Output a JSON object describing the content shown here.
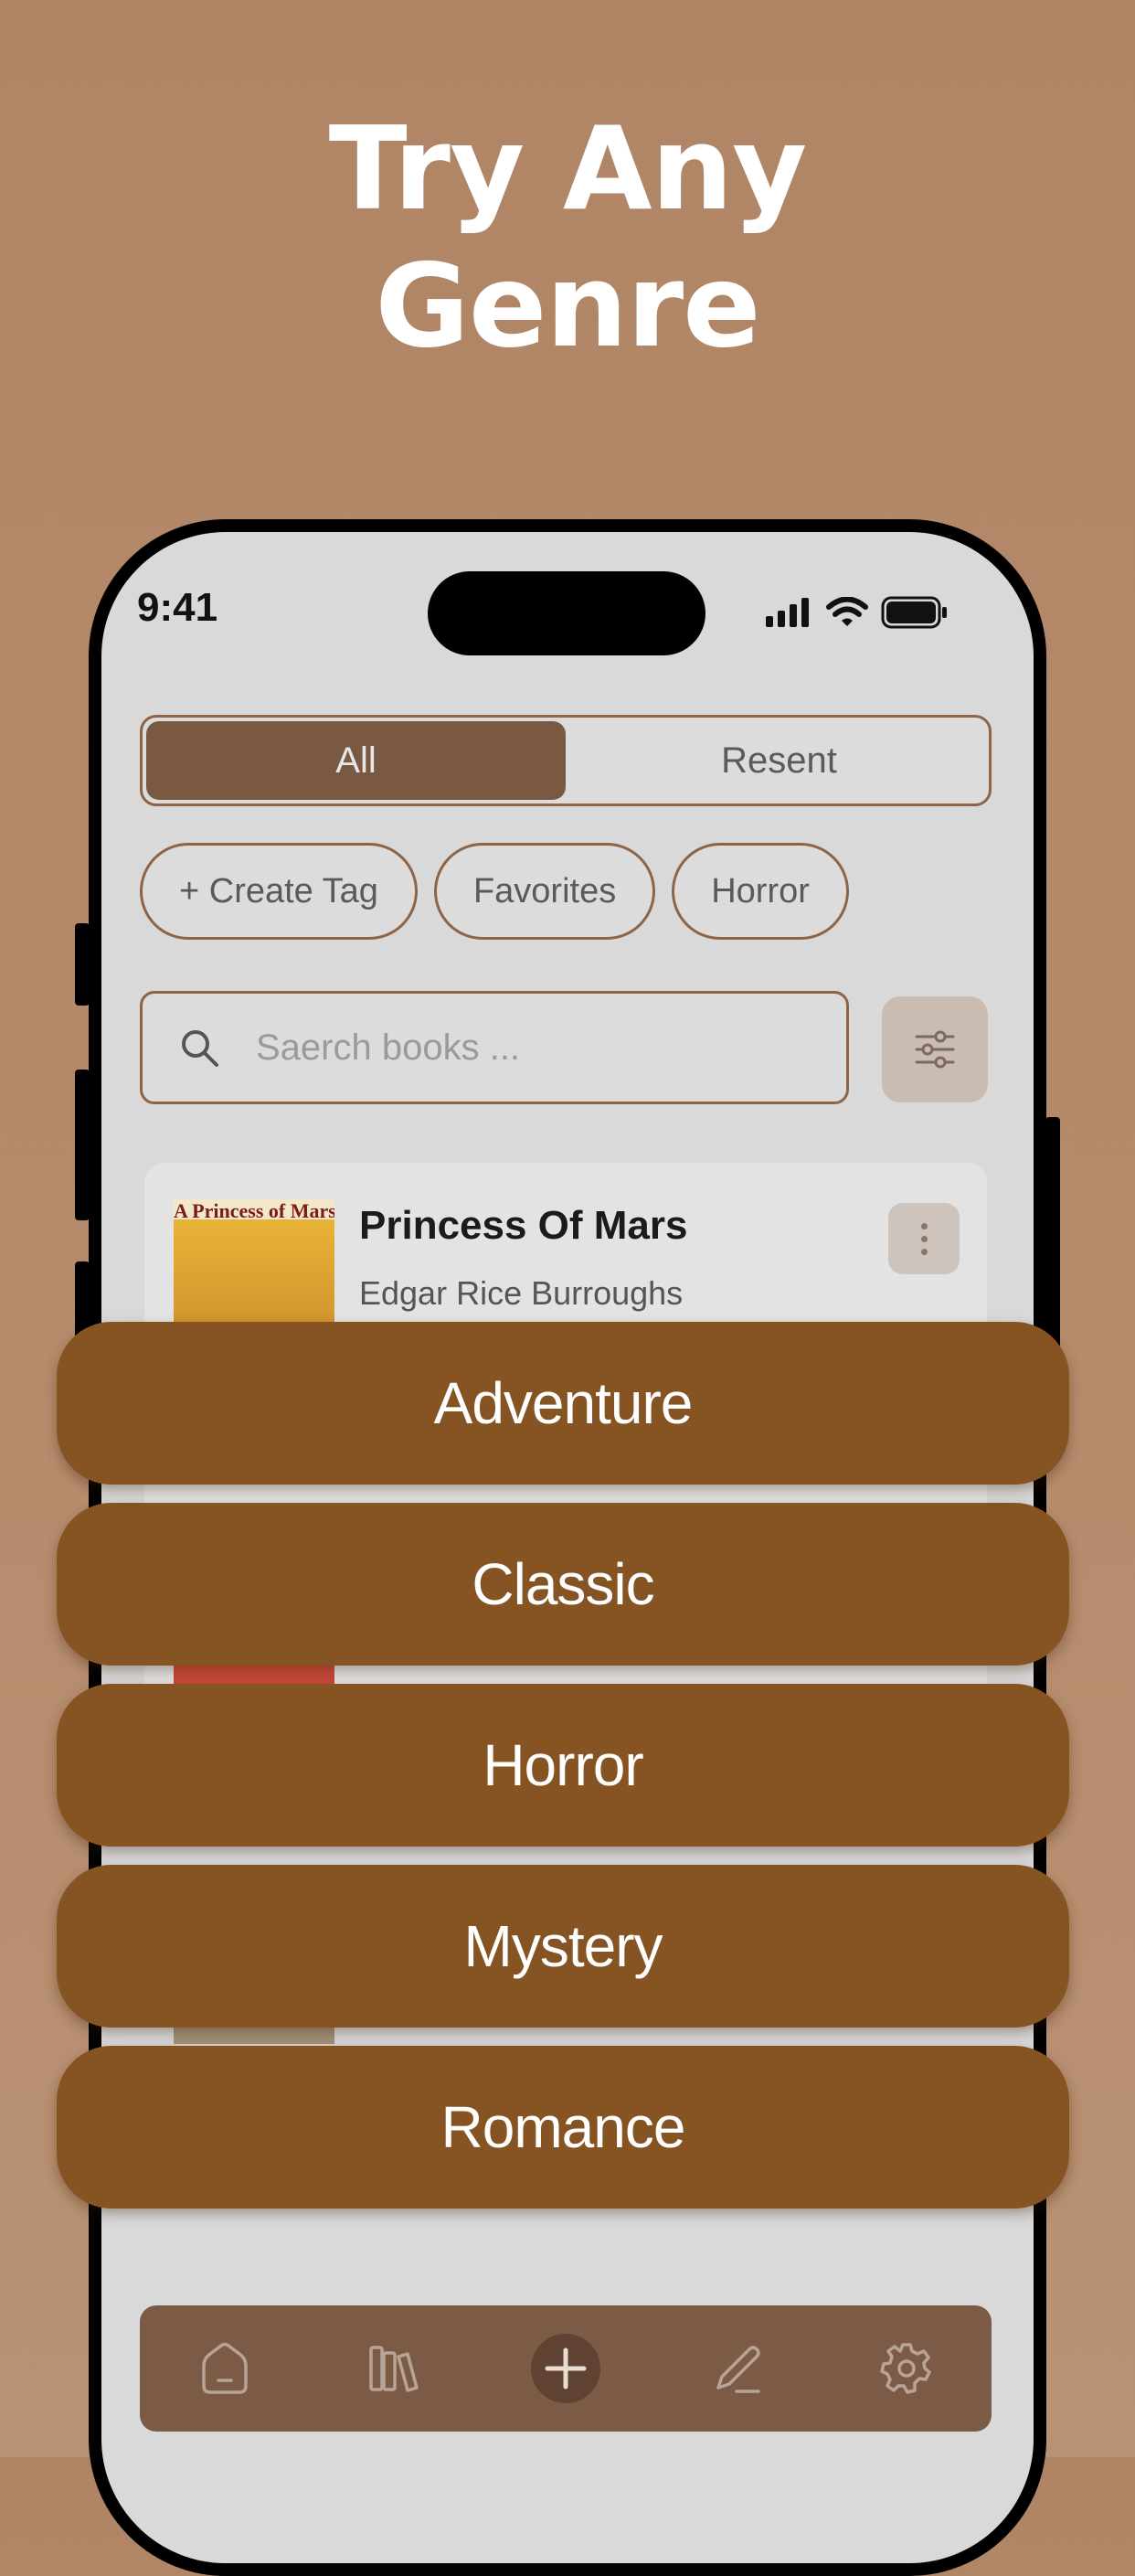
{
  "headline": {
    "line1": "Try Any",
    "line2": "Genre"
  },
  "status_bar": {
    "time": "9:41"
  },
  "segmented": {
    "all_label": "All",
    "recent_label": "Resent",
    "selected": "All"
  },
  "tags": [
    {
      "label": "+ Create Tag"
    },
    {
      "label": "Favorites"
    },
    {
      "label": "Horror"
    }
  ],
  "search": {
    "placeholder": "Saerch books ..."
  },
  "book": {
    "title": "Princess Of Mars",
    "author": "Edgar Rice Burroughs",
    "cover_title": "A Princess of Mars"
  },
  "genres": [
    "Adventure",
    "Classic",
    "Horror",
    "Mystery",
    "Romance"
  ],
  "tabbar": {
    "items": [
      {
        "icon": "home-icon"
      },
      {
        "icon": "library-icon"
      },
      {
        "icon": "add-icon"
      },
      {
        "icon": "pencil-icon"
      },
      {
        "icon": "gear-icon"
      }
    ]
  },
  "colors": {
    "background": "#b08565",
    "genre_button": "#865322",
    "accent": "#7a5943"
  }
}
